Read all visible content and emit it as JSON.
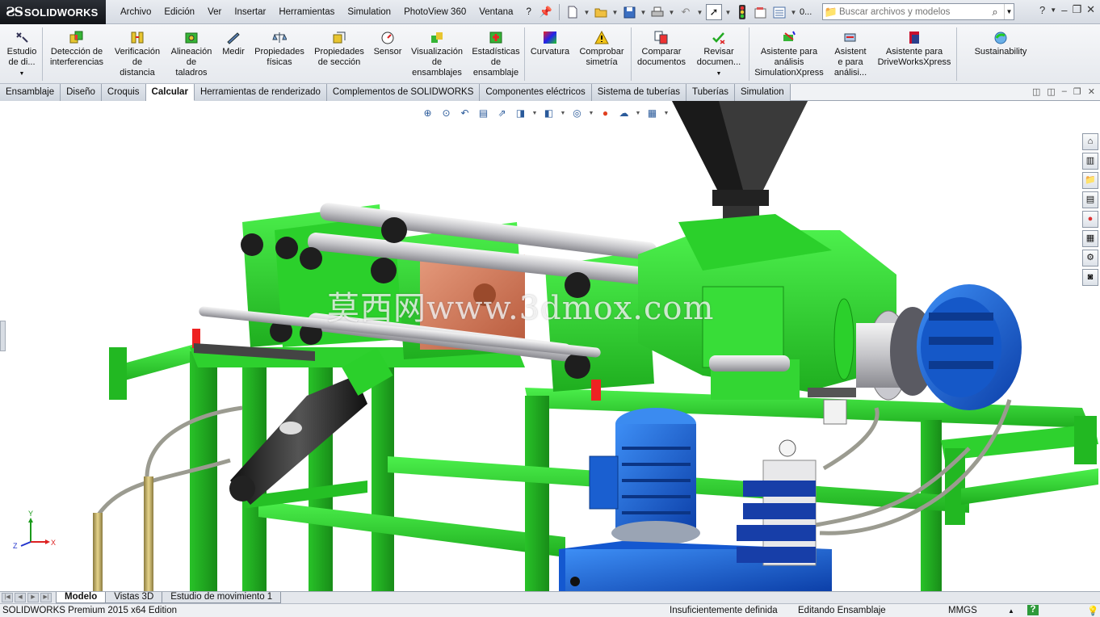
{
  "app": {
    "brand": "SOLIDWORKS"
  },
  "menu": [
    "Archivo",
    "Edición",
    "Ver",
    "Insertar",
    "Herramientas",
    "Simulation",
    "PhotoView 360",
    "Ventana",
    "?"
  ],
  "quick_toolbar": {
    "counter": "0..."
  },
  "search": {
    "placeholder": "Buscar archivos y modelos"
  },
  "commands": [
    {
      "label": "Estudio\nde di...",
      "icon": "design-study-icon"
    },
    {
      "label": "Detección de\ninterferencias",
      "icon": "interference-detection-icon"
    },
    {
      "label": "Verificación\nde\ndistancia",
      "icon": "clearance-verification-icon"
    },
    {
      "label": "Alineación\nde\ntaladros",
      "icon": "hole-alignment-icon"
    },
    {
      "label": "Medir",
      "icon": "measure-icon"
    },
    {
      "label": "Propiedades\nfísicas",
      "icon": "mass-properties-icon"
    },
    {
      "label": "Propiedades\nde sección",
      "icon": "section-properties-icon"
    },
    {
      "label": "Sensor",
      "icon": "sensor-icon"
    },
    {
      "label": "Visualización\nde\nensamblajes",
      "icon": "assembly-visualization-icon"
    },
    {
      "label": "Estadísticas\nde\nensamblaje",
      "icon": "assembly-statistics-icon"
    },
    {
      "label": "Curvatura",
      "icon": "curvature-icon"
    },
    {
      "label": "Comprobar\nsimetría",
      "icon": "check-symmetry-icon"
    },
    {
      "label": "Comparar\ndocumentos",
      "icon": "compare-documents-icon"
    },
    {
      "label": "Revisar\ndocumen...",
      "icon": "check-document-icon"
    },
    {
      "label": "Asistente para\nanálisis\nSimulationXpress",
      "icon": "simulationxpress-icon"
    },
    {
      "label": "Asistent\ne para\nanálisi...",
      "icon": "analysis-wizard-icon"
    },
    {
      "label": "Asistente para\nDriveWorksXpress",
      "icon": "driveworksxpress-icon"
    },
    {
      "label": "Sustainability",
      "icon": "sustainability-icon"
    }
  ],
  "tabs": [
    "Ensamblaje",
    "Diseño",
    "Croquis",
    "Calcular",
    "Herramientas de renderizado",
    "Complementos de SOLIDWORKS",
    "Componentes eléctricos",
    "Sistema de tuberías",
    "Tuberías",
    "Simulation"
  ],
  "active_tab": "Calcular",
  "watermark": "莫西网www.3dmox.com",
  "triad": {
    "x": "X",
    "y": "Y",
    "z": "Z"
  },
  "bottom_tabs": [
    "Modelo",
    "Vistas 3D",
    "Estudio de movimiento 1"
  ],
  "active_bottom_tab": "Modelo",
  "status": {
    "product": "SOLIDWORKS Premium 2015 x64 Edition",
    "definition": "Insuficientemente definida",
    "mode": "Editando Ensamblaje",
    "units": "MMGS",
    "help": "?"
  },
  "colors": {
    "frame_green": "#2fd42f",
    "motor_blue": "#1565d8",
    "mold_copper": "#d77a5a",
    "steel_gray": "#c8c8c8"
  }
}
